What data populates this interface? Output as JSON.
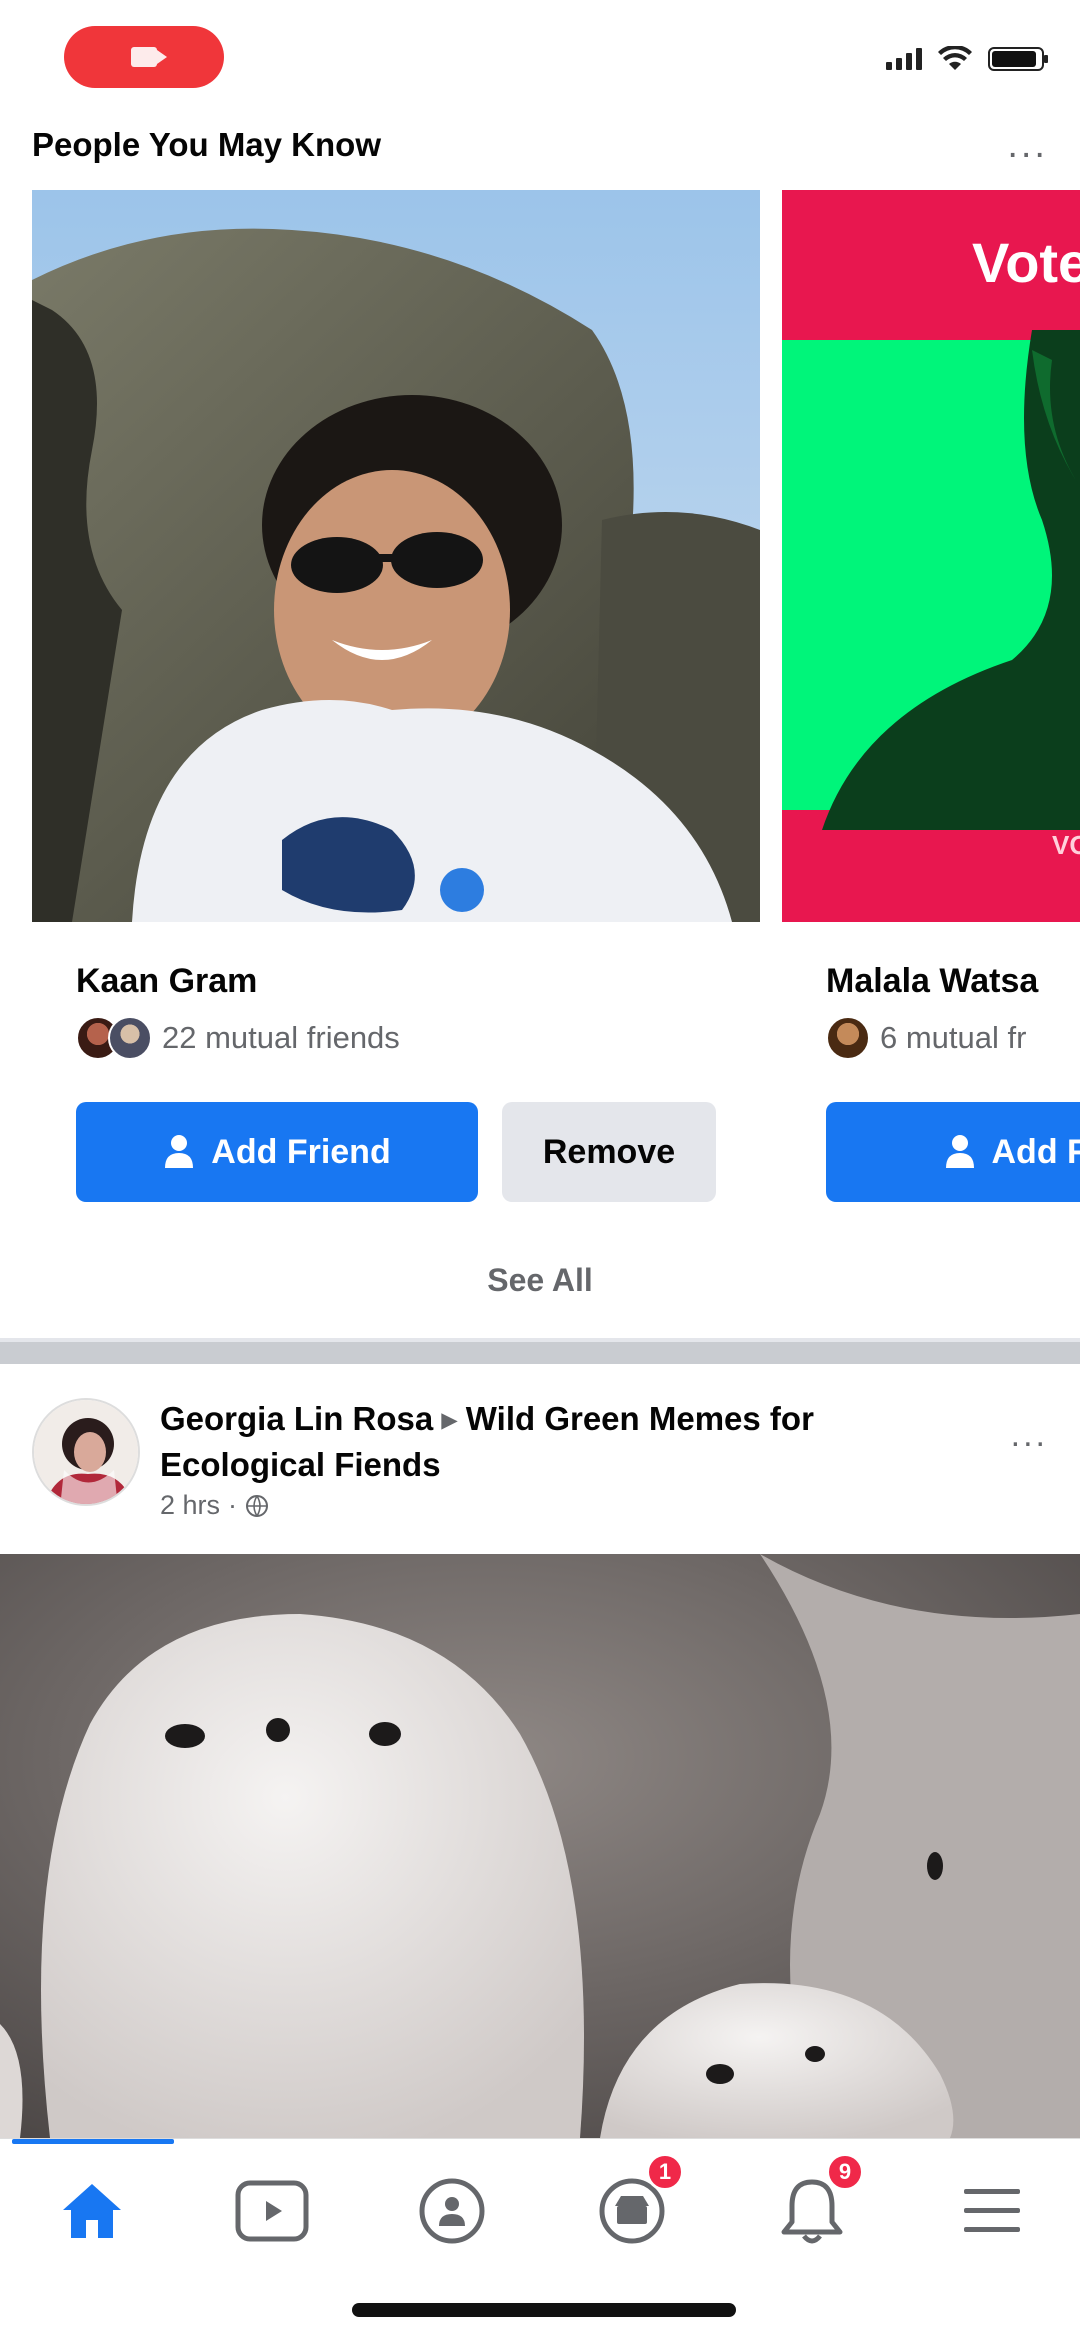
{
  "status_bar": {
    "recording_icon": "video-camera-icon",
    "icons": [
      "cellular-signal-icon",
      "wifi-icon",
      "battery-icon"
    ]
  },
  "pymk": {
    "title": "People You May Know",
    "more_label": "...",
    "see_all": "See All",
    "cards": [
      {
        "name": "Kaan Gram",
        "mutual": "22 mutual friends",
        "add_label": "Add Friend",
        "remove_label": "Remove"
      },
      {
        "name": "Malala Watsa",
        "mutual": "6 mutual fr",
        "add_label": "Add Fri",
        "photo_banner": "Vote",
        "photo_footer": "VOTE"
      }
    ]
  },
  "post": {
    "author": "Georgia Lin Rosa",
    "separator": "▸",
    "group": "Wild Green Memes for Ecological Fiends",
    "time": "2 hrs",
    "privacy_icon": "globe-icon",
    "more_label": "..."
  },
  "tabbar": {
    "tabs": [
      {
        "name": "home",
        "icon": "home-icon",
        "active": true
      },
      {
        "name": "watch",
        "icon": "watch-icon"
      },
      {
        "name": "groups",
        "icon": "groups-icon"
      },
      {
        "name": "marketplace",
        "icon": "marketplace-icon",
        "badge": "1"
      },
      {
        "name": "notifications",
        "icon": "bell-icon",
        "badge": "9"
      },
      {
        "name": "menu",
        "icon": "menu-icon"
      }
    ]
  },
  "colors": {
    "accent": "#1877f2",
    "badge": "#f02849",
    "record": "#f0363a",
    "vote_green": "#00f57a",
    "vote_red": "#e8174f"
  }
}
